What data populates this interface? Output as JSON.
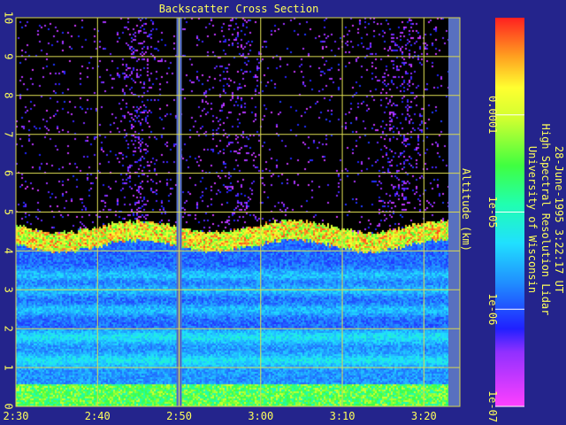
{
  "chart_data": {
    "type": "heatmap",
    "title": "Backscatter Cross Section",
    "ylabel": "Altitude (km)",
    "xlabel": "",
    "x_ticks": [
      "2:30",
      "2:40",
      "2:50",
      "3:00",
      "3:10",
      "3:20"
    ],
    "x_range_minutes": [
      150,
      203
    ],
    "y_ticks": [
      0,
      1,
      2,
      3,
      4,
      5,
      6,
      7,
      8,
      9,
      10
    ],
    "ylim": [
      0,
      10
    ],
    "grid": true,
    "colorbar": {
      "scale": "log",
      "range": [
        1e-07,
        0.001
      ],
      "ticks": [
        "0.0001",
        "1e-05",
        "1e-06",
        "1e-07"
      ],
      "tick_values": [
        0.0001,
        1e-05,
        1e-06,
        1e-07
      ],
      "placement": "right"
    },
    "data_gaps_minutes": [
      [
        170,
        171
      ]
    ],
    "features": {
      "boundary_layer_km": [
        0.2,
        0.6
      ],
      "aerosol_layers_km": [
        1.2,
        1.8,
        2.5,
        3.0,
        3.4
      ],
      "cloud_layer_km": [
        4.1,
        4.5
      ]
    }
  },
  "info": {
    "line1": "University of Wisconsin",
    "line2": "High Spectral Resolution Lidar",
    "line3": "28-June-1995  3:22:17 UT"
  },
  "colors": {
    "background": "#24248c",
    "grid": "#d8d850",
    "text": "#ffff5a",
    "gap": "#5870c0",
    "plot_bg": "#000000"
  }
}
